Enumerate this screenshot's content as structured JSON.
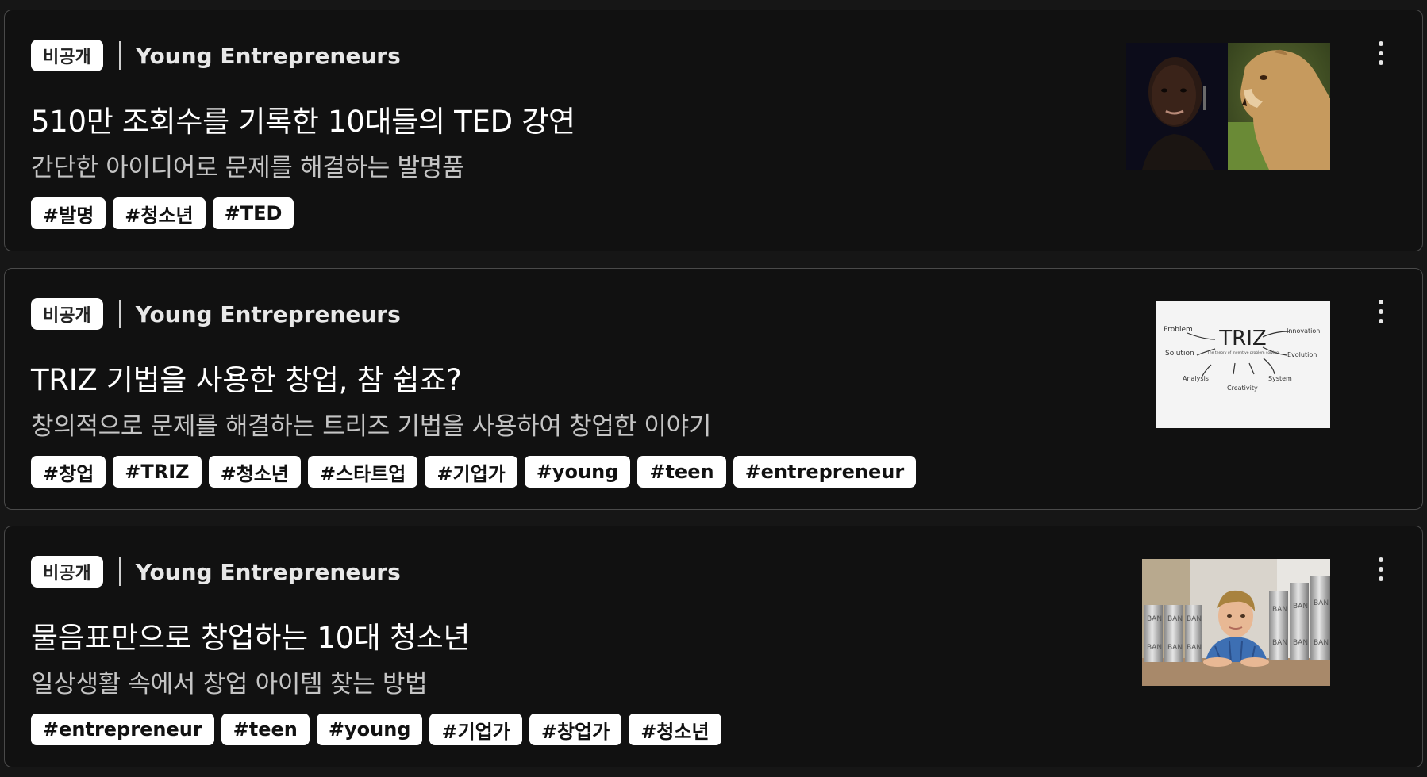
{
  "cards": [
    {
      "badge": "비공개",
      "channel": "Young Entrepreneurs",
      "title": "510만 조회수를 기록한 10대들의 TED 강연",
      "subtitle": "간단한 아이디어로 문제를 해결하는 발명품",
      "tags": [
        "#발명",
        "#청소년",
        "#TED"
      ]
    },
    {
      "badge": "비공개",
      "channel": "Young Entrepreneurs",
      "title": "TRIZ 기법을 사용한 창업, 참 쉽죠?",
      "subtitle": "창의적으로 문제를 해결하는 트리즈 기법을 사용하여 창업한 이야기",
      "tags": [
        "#창업",
        "#TRIZ",
        "#청소년",
        "#스타트업",
        "#기업가",
        "#young",
        "#teen",
        "#entrepreneur"
      ],
      "thumbnail_text": {
        "title": "TRIZ",
        "subtitle": "The theory of inventive problem solving",
        "words": [
          "Problem",
          "Innovation",
          "Solution",
          "Evolution",
          "Analysis",
          "System",
          "Creativity"
        ]
      }
    },
    {
      "badge": "비공개",
      "channel": "Young Entrepreneurs",
      "title": "물음표만으로 창업하는 10대 청소년",
      "subtitle": "일상생활 속에서 창업 아이템 찾는 방법",
      "tags": [
        "#entrepreneur",
        "#teen",
        "#young",
        "#기업가",
        "#창업가",
        "#청소년"
      ],
      "thumbnail_text": {
        "can_label": "BAN"
      }
    }
  ]
}
